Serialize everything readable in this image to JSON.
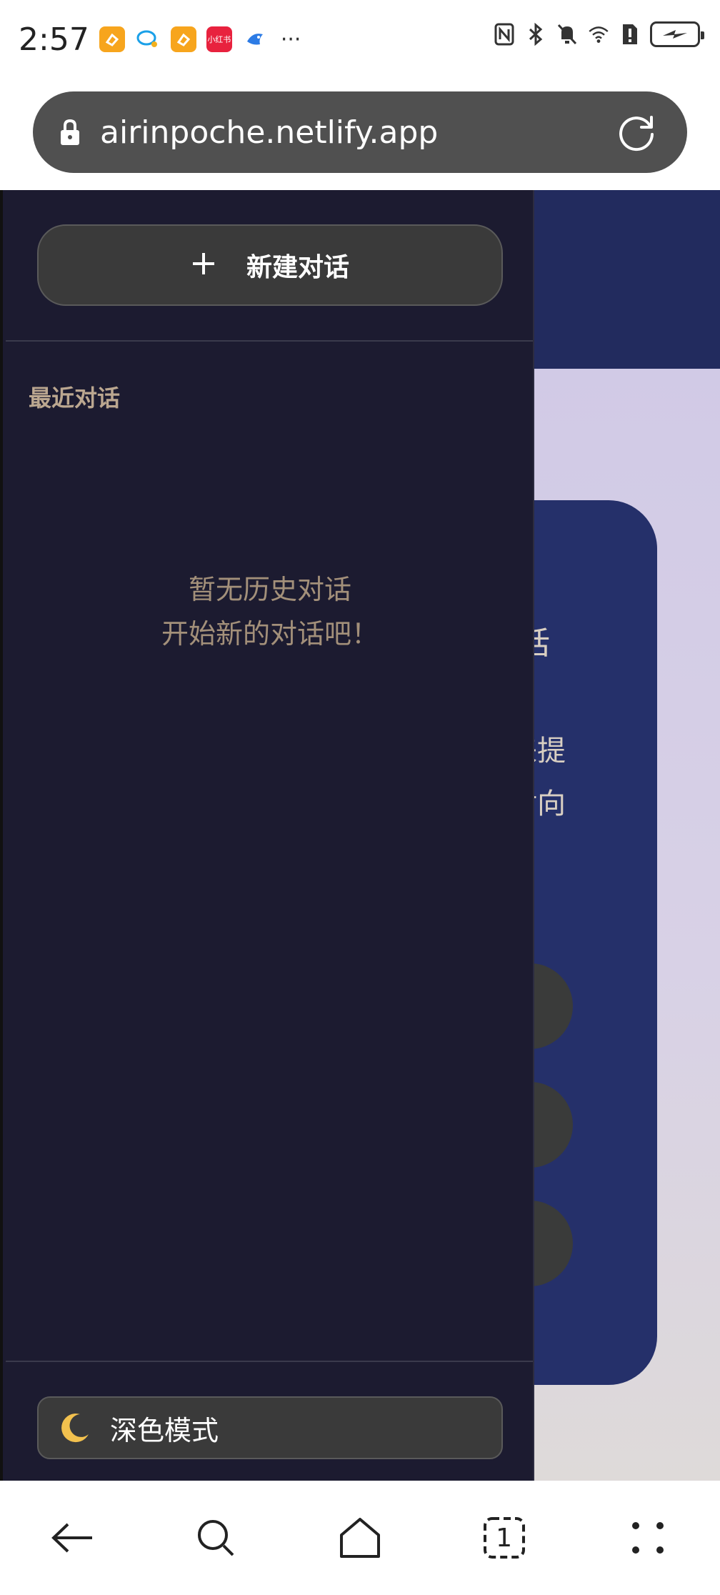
{
  "status_bar": {
    "time": "2:57",
    "apps": [
      "orange-app-icon",
      "chat-app-icon",
      "orange-app-icon",
      "xiaohongshu-icon",
      "bird-app-icon"
    ],
    "xiaohongshu_label": "小红书",
    "more": "···"
  },
  "browser": {
    "url": "airinpoche.netlify.app",
    "tab_count": "1"
  },
  "sidebar": {
    "new_chat_label": "新建对话",
    "recent_title": "最近对话",
    "empty_line1": "暂无历史对话",
    "empty_line2": "开始新的对话吧！",
    "dark_mode_label": "深色模式"
  },
  "main": {
    "card_partial_1": "话",
    "card_partial_2": "来提",
    "card_partial_3": "对向",
    "card_partial_4": "。"
  },
  "colors": {
    "sidebar_bg": "#1c1b30",
    "header_bg": "#222b5e",
    "card_bg": "#25306a",
    "accent_text": "#bba790"
  }
}
